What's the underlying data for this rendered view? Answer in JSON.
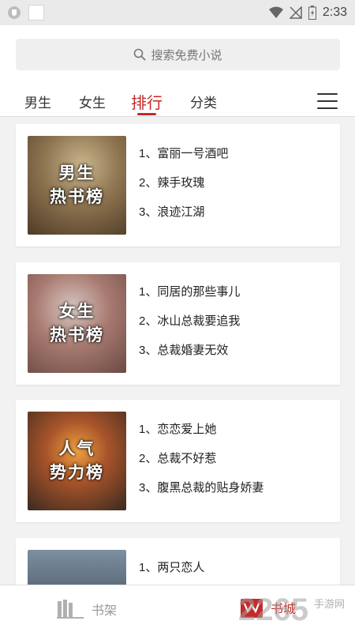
{
  "status_bar": {
    "time": "2:33"
  },
  "search": {
    "placeholder": "搜索免费小说"
  },
  "tabs": [
    {
      "label": "男生"
    },
    {
      "label": "女生"
    },
    {
      "label": "排行",
      "active": true
    },
    {
      "label": "分类"
    }
  ],
  "rankings": [
    {
      "cover_title": "男生\n热书榜",
      "items": [
        "1、富丽一号酒吧",
        "2、辣手玫瑰",
        "3、浪迹江湖"
      ]
    },
    {
      "cover_title": "女生\n热书榜",
      "items": [
        "1、同居的那些事儿",
        "2、冰山总裁要追我",
        "3、总裁婚妻无效"
      ]
    },
    {
      "cover_title": "人气\n势力榜",
      "items": [
        "1、恋恋爱上她",
        "2、总裁不好惹",
        "3、腹黑总裁的贴身娇妻"
      ]
    },
    {
      "cover_title": "",
      "items": [
        "1、两只恋人"
      ]
    }
  ],
  "bottom_nav": {
    "shelf_label": "书架",
    "store_label": "书城"
  },
  "watermark": {
    "number": "2265",
    "suffix": "手游网"
  },
  "colors": {
    "accent": "#c62828",
    "background": "#f2f2f2"
  }
}
